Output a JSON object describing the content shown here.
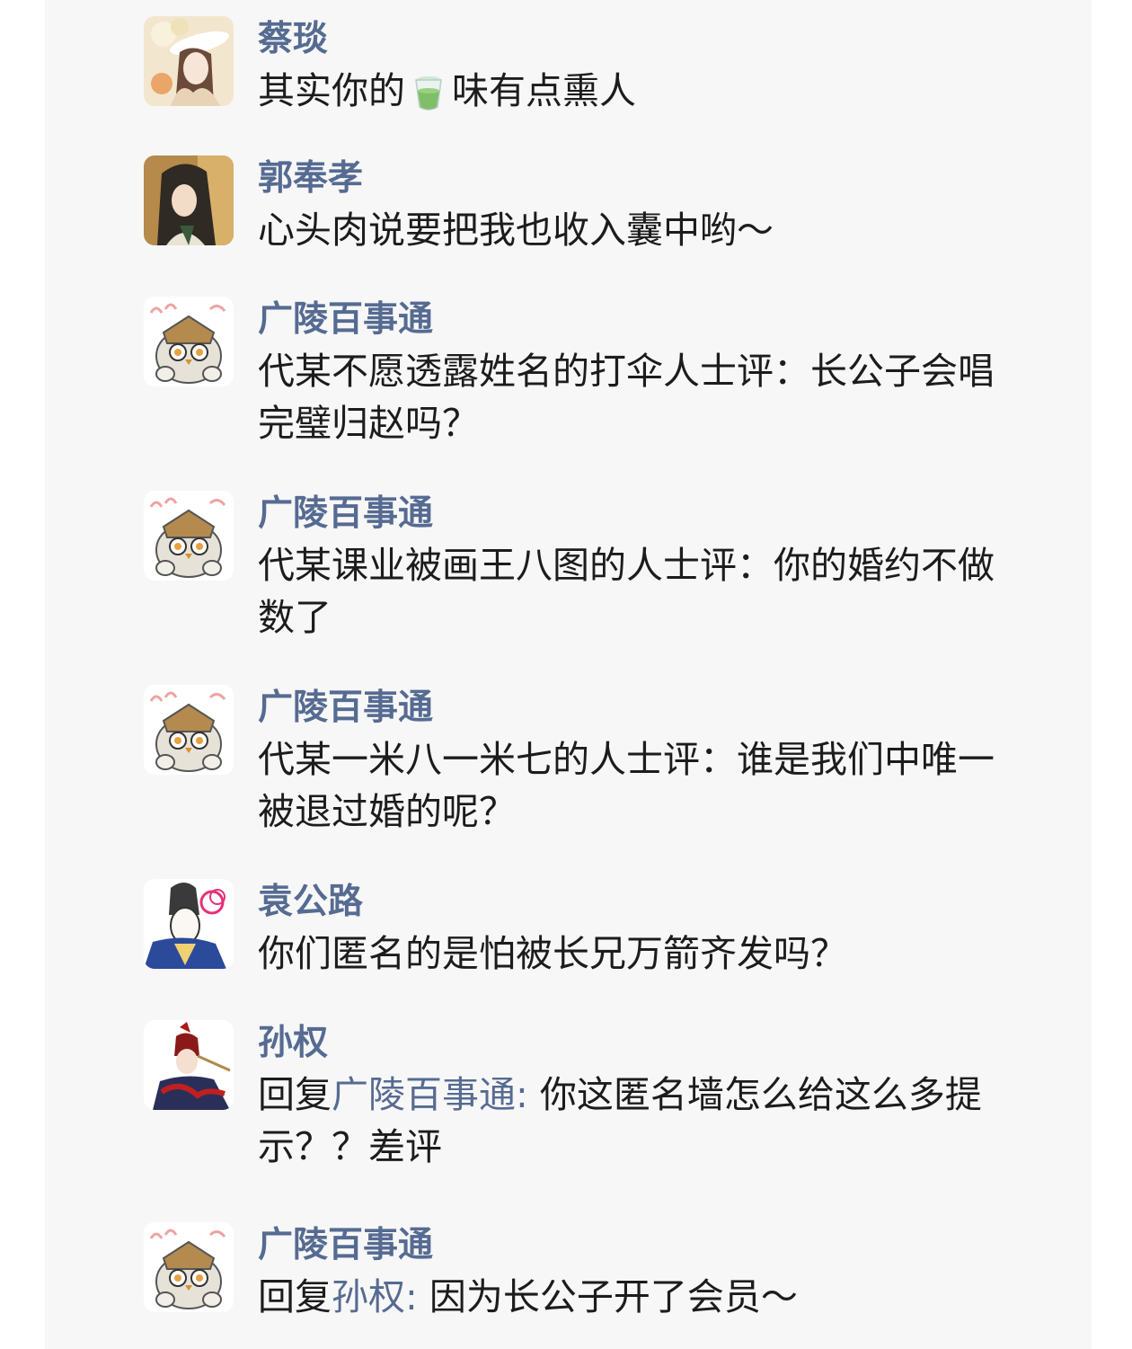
{
  "comments": [
    {
      "name": "蔡琰",
      "text_before": "其实你的",
      "icon": "tea-cup-icon",
      "text_after": "味有点熏人"
    },
    {
      "name": "郭奉孝",
      "text": "心头肉说要把我也收入囊中哟～"
    },
    {
      "name": "广陵百事通",
      "text": "代某不愿透露姓名的打伞人士评：长公子会唱完璧归赵吗？"
    },
    {
      "name": "广陵百事通",
      "text": "代某课业被画王八图的人士评：你的婚约不做数了"
    },
    {
      "name": "广陵百事通",
      "text": "代某一米八一米七的人士评：谁是我们中唯一被退过婚的呢？"
    },
    {
      "name": "袁公路",
      "text": "你们匿名的是怕被长兄万箭齐发吗？"
    },
    {
      "name": "孙权",
      "reply_prefix": "回复",
      "reply_to": "广陵百事通:",
      "text": " 你这匿名墙怎么给这么多提示？？差评"
    },
    {
      "name": "广陵百事通",
      "reply_prefix": "回复",
      "reply_to": "孙权:",
      "text": " 因为长公子开了会员～"
    }
  ],
  "colors": {
    "panel_bg": "#f7f7f7",
    "name": "#566b92",
    "text": "#1c1c1c"
  }
}
